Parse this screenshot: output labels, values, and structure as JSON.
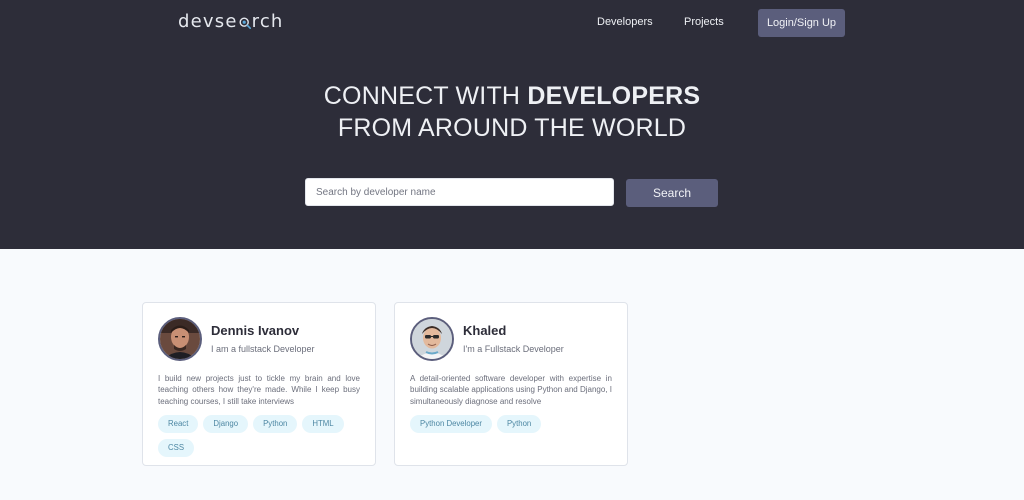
{
  "header": {
    "logo_prefix": "devse",
    "logo_suffix": "rch",
    "nav": {
      "developers": "Developers",
      "projects": "Projects",
      "login": "Login/Sign Up"
    }
  },
  "hero": {
    "line1_prefix": "CONNECT WITH",
    "line1_bold": "DEVELOPERS",
    "line2": "FROM AROUND THE WORLD",
    "search": {
      "placeholder": "Search by developer name",
      "value": "",
      "button": "Search"
    }
  },
  "developers": [
    {
      "name": "Dennis Ivanov",
      "short_intro": "I am a fullstack Developer",
      "bio": "I build new projects just to tickle my brain and love teaching others how they're made. While I keep busy teaching courses, I still take interviews",
      "skills": [
        "React",
        "Django",
        "Python",
        "HTML",
        "CSS"
      ]
    },
    {
      "name": "Khaled",
      "short_intro": "I'm a Fullstack Developer",
      "bio": "A detail-oriented software developer with expertise in building scalable applications using Python and Django, I simultaneously diagnose and resolve",
      "skills": [
        "Python Developer",
        "Python"
      ]
    }
  ],
  "icons": {
    "logo_lens": "magnifier-icon",
    "avatar_1": "avatar-dennis",
    "avatar_2": "avatar-khaled"
  },
  "colors": {
    "header_bg": "#2d2d39",
    "accent": "#5b5e7c",
    "page_bg": "#f8fafd",
    "tag_bg": "#e5f6fc",
    "tag_text": "#4d87a3"
  }
}
